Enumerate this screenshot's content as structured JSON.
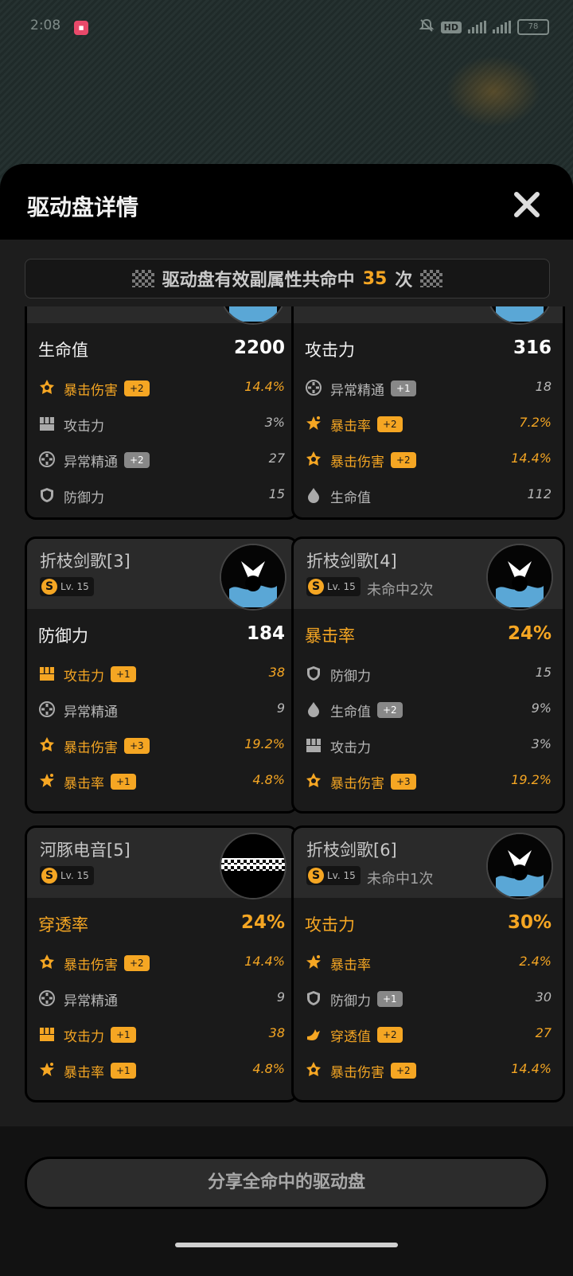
{
  "status": {
    "time": "2:08",
    "app_icon": "pink-app-icon",
    "hd": "HD",
    "battery": "78"
  },
  "sheet": {
    "title": "驱动盘详情",
    "banner_prefix": "驱动盘有效副属性共命中",
    "banner_count": "35",
    "banner_suffix": "次"
  },
  "cards": [
    {
      "name": "",
      "level": "",
      "miss": "",
      "main": {
        "label": "生命值",
        "value": "2200",
        "gold": false
      },
      "subs": [
        {
          "icon": "crit-dmg-icon",
          "label": "暴击伤害",
          "badge": "+2",
          "value": "14.4%",
          "gold": true
        },
        {
          "icon": "atk-icon",
          "label": "攻击力",
          "badge": "",
          "value": "3%",
          "gold": false
        },
        {
          "icon": "anomaly-icon",
          "label": "异常精通",
          "badge": "+2",
          "value": "27",
          "gold": false
        },
        {
          "icon": "def-icon",
          "label": "防御力",
          "badge": "",
          "value": "15",
          "gold": false
        }
      ]
    },
    {
      "name": "",
      "level": "",
      "miss": "",
      "main": {
        "label": "攻击力",
        "value": "316",
        "gold": false
      },
      "subs": [
        {
          "icon": "anomaly-icon",
          "label": "异常精通",
          "badge": "+1",
          "value": "18",
          "gold": false
        },
        {
          "icon": "crit-rate-icon",
          "label": "暴击率",
          "badge": "+2",
          "value": "7.2%",
          "gold": true
        },
        {
          "icon": "crit-dmg-icon",
          "label": "暴击伤害",
          "badge": "+2",
          "value": "14.4%",
          "gold": true
        },
        {
          "icon": "hp-icon",
          "label": "生命值",
          "badge": "",
          "value": "112",
          "gold": false
        }
      ]
    },
    {
      "name": "折枝剑歌[3]",
      "level": "Lv. 15",
      "miss": "",
      "main": {
        "label": "防御力",
        "value": "184",
        "gold": false
      },
      "subs": [
        {
          "icon": "atk-icon",
          "label": "攻击力",
          "badge": "+1",
          "value": "38",
          "gold": true
        },
        {
          "icon": "anomaly-icon",
          "label": "异常精通",
          "badge": "",
          "value": "9",
          "gold": false
        },
        {
          "icon": "crit-dmg-icon",
          "label": "暴击伤害",
          "badge": "+3",
          "value": "19.2%",
          "gold": true
        },
        {
          "icon": "crit-rate-icon",
          "label": "暴击率",
          "badge": "+1",
          "value": "4.8%",
          "gold": true
        }
      ]
    },
    {
      "name": "折枝剑歌[4]",
      "level": "Lv. 15",
      "miss": "未命中2次",
      "main": {
        "label": "暴击率",
        "value": "24%",
        "gold": true
      },
      "subs": [
        {
          "icon": "def-icon",
          "label": "防御力",
          "badge": "",
          "value": "15",
          "gold": false
        },
        {
          "icon": "hp-icon",
          "label": "生命值",
          "badge": "+2",
          "value": "9%",
          "gold": false
        },
        {
          "icon": "atk-icon",
          "label": "攻击力",
          "badge": "",
          "value": "3%",
          "gold": false
        },
        {
          "icon": "crit-dmg-icon",
          "label": "暴击伤害",
          "badge": "+3",
          "value": "19.2%",
          "gold": true
        }
      ]
    },
    {
      "name": "河豚电音[5]",
      "level": "Lv. 15",
      "miss": "",
      "main": {
        "label": "穿透率",
        "value": "24%",
        "gold": true
      },
      "subs": [
        {
          "icon": "crit-dmg-icon",
          "label": "暴击伤害",
          "badge": "+2",
          "value": "14.4%",
          "gold": true
        },
        {
          "icon": "anomaly-icon",
          "label": "异常精通",
          "badge": "",
          "value": "9",
          "gold": false
        },
        {
          "icon": "atk-icon",
          "label": "攻击力",
          "badge": "+1",
          "value": "38",
          "gold": true
        },
        {
          "icon": "crit-rate-icon",
          "label": "暴击率",
          "badge": "+1",
          "value": "4.8%",
          "gold": true
        }
      ]
    },
    {
      "name": "折枝剑歌[6]",
      "level": "Lv. 15",
      "miss": "未命中1次",
      "main": {
        "label": "攻击力",
        "value": "30%",
        "gold": true
      },
      "subs": [
        {
          "icon": "crit-rate-icon",
          "label": "暴击率",
          "badge": "",
          "value": "2.4%",
          "gold": true
        },
        {
          "icon": "def-icon",
          "label": "防御力",
          "badge": "+1",
          "value": "30",
          "gold": false
        },
        {
          "icon": "pen-icon",
          "label": "穿透值",
          "badge": "+2",
          "value": "27",
          "gold": true
        },
        {
          "icon": "crit-dmg-icon",
          "label": "暴击伤害",
          "badge": "+2",
          "value": "14.4%",
          "gold": true
        }
      ]
    }
  ],
  "share_button": "分享全命中的驱动盘",
  "colors": {
    "accent": "#f5a623",
    "badge_gray": "#888888"
  }
}
